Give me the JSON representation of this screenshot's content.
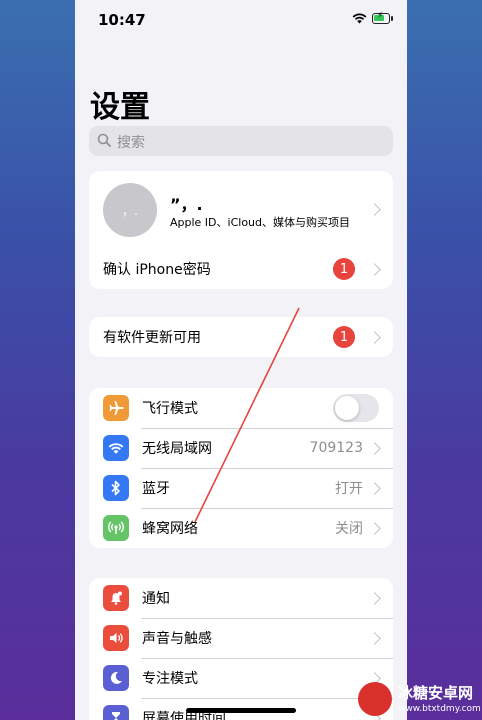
{
  "status_bar": {
    "time": "10:47"
  },
  "page": {
    "title": "设置"
  },
  "search": {
    "placeholder": "搜索"
  },
  "profile": {
    "avatar_text": "，.",
    "name": "”，.",
    "subtitle": "Apple ID、iCloud、媒体与购买项目"
  },
  "confirm_row": {
    "label": "确认 iPhone密码",
    "badge": "1"
  },
  "update_row": {
    "label": "有软件更新可用",
    "badge": "1"
  },
  "connectivity": [
    {
      "label": "飞行模式",
      "value": "",
      "icon": "airplane-icon",
      "color": "#f09a37"
    },
    {
      "label": "无线局域网",
      "value": "709123",
      "icon": "wifi-icon",
      "color": "#3478f6"
    },
    {
      "label": "蓝牙",
      "value": "打开",
      "icon": "bluetooth-icon",
      "color": "#3478f6"
    },
    {
      "label": "蜂窝网络",
      "value": "关闭",
      "icon": "cellular-icon",
      "color": "#65c466"
    }
  ],
  "notifications": [
    {
      "label": "通知",
      "icon": "bell-icon",
      "color": "#eb4e3d"
    },
    {
      "label": "声音与触感",
      "icon": "speaker-icon",
      "color": "#eb4e3d"
    },
    {
      "label": "专注模式",
      "icon": "moon-icon",
      "color": "#5b5fd4"
    },
    {
      "label": "屏幕使用时间",
      "icon": "hourglass-icon",
      "color": "#5b5fd4"
    }
  ],
  "watermark": {
    "title": "冰糖安卓网",
    "url": "www.btxtdmy.com"
  }
}
